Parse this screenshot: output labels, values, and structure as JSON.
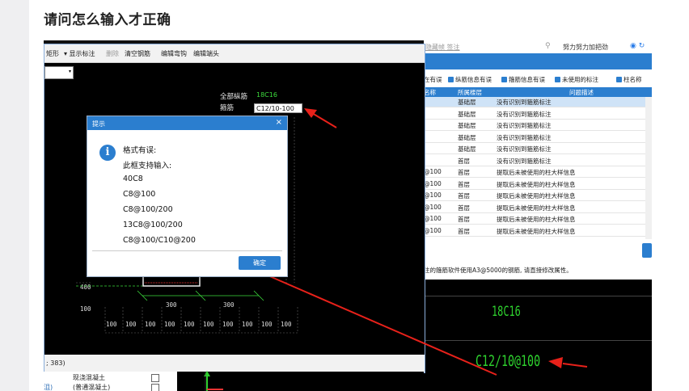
{
  "question_title": "请问怎么输入才正确",
  "main_window": {
    "toolbar": [
      "矩形",
      "▾ 显示标注",
      "删除",
      "清空钢筋",
      "编辑弯钩",
      "编辑端头"
    ],
    "status_text": "; 383)",
    "cad": {
      "label_longbar": "全部纵筋",
      "value_longbar": "18C16",
      "label_stirrup": "箍筋",
      "stirrup_input_value": "C12/10-100",
      "dims_300": [
        "300",
        "300"
      ],
      "dims_100": [
        "100",
        "100",
        "100",
        "100",
        "100",
        "100",
        "100",
        "100",
        "100",
        "100"
      ],
      "dim_left_top": "400",
      "dim_left_bottom": "100"
    },
    "props": [
      {
        "left": "",
        "right": "现浇混凝土"
      },
      {
        "left": "沮)",
        "right": "(普通混凝土)"
      }
    ]
  },
  "dialog": {
    "title": "提示",
    "close": "×",
    "icon": "info-icon",
    "lines": [
      "格式有误:",
      "此框支持输入:",
      "40C8",
      "C8@100",
      "C8@100/200",
      "13C8@100/200",
      "C8@100/C10@200"
    ],
    "ok_label": "确定"
  },
  "right_window": {
    "top_link": "隐藏帧  签注",
    "nickname": "努力努力加把劲",
    "filters": [
      "在有误",
      "纵筋信息有误",
      "箍筋信息有误",
      "未使用的标注",
      "柱名称"
    ],
    "headers": [
      "名称",
      "所属楼层",
      "问题描述"
    ],
    "rows": [
      {
        "a": "",
        "floor": "基础层",
        "desc": "没有识别到箍筋标注",
        "sel": true
      },
      {
        "a": "",
        "floor": "基础层",
        "desc": "没有识别到箍筋标注"
      },
      {
        "a": "",
        "floor": "基础层",
        "desc": "没有识别到箍筋标注"
      },
      {
        "a": "",
        "floor": "基础层",
        "desc": "没有识别到箍筋标注"
      },
      {
        "a": "",
        "floor": "基础层",
        "desc": "没有识别到箍筋标注"
      },
      {
        "a": "",
        "floor": "首层",
        "desc": "没有识别到箍筋标注"
      },
      {
        "a": "@100",
        "floor": "首层",
        "desc": "提取后未被使用的柱大样信息"
      },
      {
        "a": "@100",
        "floor": "首层",
        "desc": "提取后未被使用的柱大样信息"
      },
      {
        "a": "@100",
        "floor": "首层",
        "desc": "提取后未被使用的柱大样信息"
      },
      {
        "a": "@100",
        "floor": "首层",
        "desc": "提取后未被使用的柱大样信息"
      },
      {
        "a": "@100",
        "floor": "首层",
        "desc": "提取后未被使用的柱大样信息"
      },
      {
        "a": "@100",
        "floor": "首层",
        "desc": "提取后未被使用的柱大样信息"
      }
    ],
    "note": "注的箍筋软件使用A3@5000的钢筋, 请直接修改属性。",
    "cad_text_1": "18C16",
    "cad_text_2": "C12/10@100"
  },
  "colors": {
    "accent": "#2b7ecf",
    "arrow": "#e8211a",
    "cad_green": "#2ed12e"
  }
}
